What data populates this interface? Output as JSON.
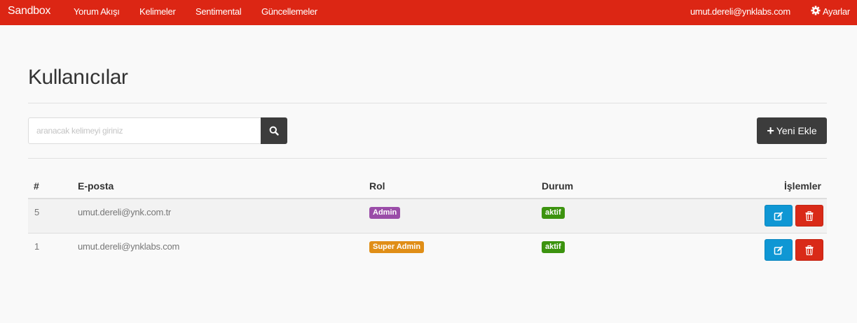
{
  "navbar": {
    "brand": "Sandbox",
    "items": [
      {
        "label": "Yorum Akışı"
      },
      {
        "label": "Kelimeler"
      },
      {
        "label": "Sentimental"
      },
      {
        "label": "Güncellemeler"
      }
    ],
    "user_email": "umut.dereli@ynklabs.com",
    "settings_label": "Ayarlar",
    "color": "#dc2614"
  },
  "page": {
    "title": "Kullanıcılar"
  },
  "search": {
    "placeholder": "aranacak kelimeyi giriniz",
    "icon": "search-icon"
  },
  "add_button": {
    "label": "Yeni Ekle",
    "icon": "plus-icon"
  },
  "table": {
    "headers": [
      "#",
      "E-posta",
      "Rol",
      "Durum",
      "İşlemler"
    ],
    "rows": [
      {
        "id": "5",
        "email": "umut.dereli@ynk.com.tr",
        "role": "Admin",
        "role_color": "#9a4ca8",
        "status": "aktif",
        "status_color": "#3c930f"
      },
      {
        "id": "1",
        "email": "umut.dereli@ynklabs.com",
        "role": "Super Admin",
        "role_color": "#e08e17",
        "status": "aktif",
        "status_color": "#3c930f"
      }
    ],
    "actions": {
      "edit_icon": "edit-icon",
      "delete_icon": "trash-icon",
      "edit_color": "#0f97d4",
      "delete_color": "#d92a18"
    }
  }
}
